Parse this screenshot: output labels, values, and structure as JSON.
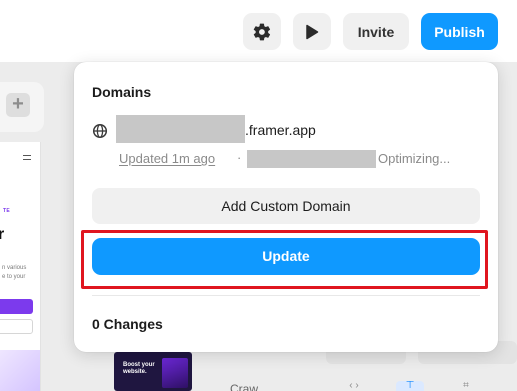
{
  "toolbar": {
    "settings_icon": "gear-icon",
    "play_icon": "play-icon",
    "invite_label": "Invite",
    "publish_label": "Publish",
    "publish_color": "#0f99ff"
  },
  "domains_popover": {
    "title": "Domains",
    "globe_icon": "globe-icon",
    "domain_suffix": ".framer.app",
    "updated_text": "Updated 1m ago",
    "separator": "·",
    "status_text": "Optimizing...",
    "add_custom_domain_label": "Add Custom Domain",
    "update_label": "Update",
    "update_color": "#0f99ff",
    "highlight_color": "#e0151f",
    "changes_label": "0 Changes"
  },
  "background": {
    "add_icon": "plus-icon",
    "preview_tag": "TE",
    "preview_heading": "r",
    "preview_text": "n various\ne to your",
    "thumbnail_text": "Boost your\nwebsite.",
    "faded_label": "Craw"
  }
}
